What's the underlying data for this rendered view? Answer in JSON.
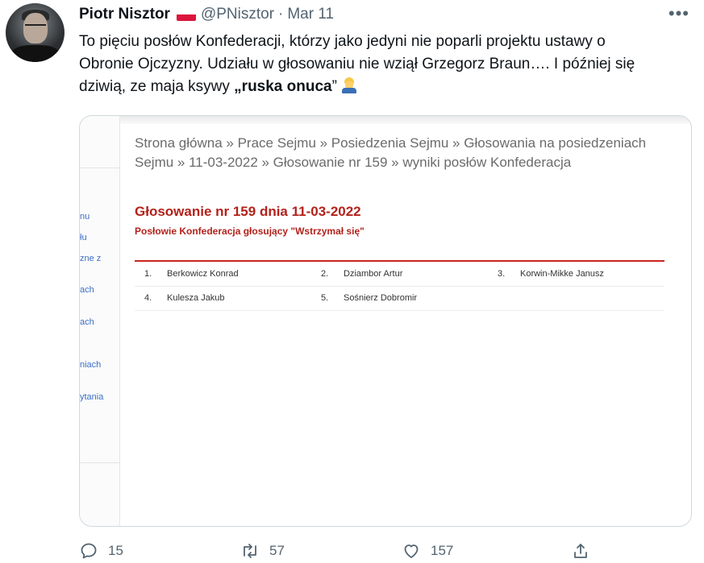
{
  "tweet": {
    "author_name": "Piotr Nisztor",
    "handle": "@PNisztor",
    "separator": "·",
    "date": "Mar 11",
    "more_label": "•••",
    "text_part1": "To pięciu posłów Konfederacji, którzy jako jedyni nie poparli projektu ustawy o Obronie Ojczyzny. Udziału w głosowaniu nie wziął Grzegorz Braun…. I później się dziwią, ze maja ksywy ",
    "text_bold": "„ruska onuca",
    "text_part2": "”",
    "flag_icon": "poland-flag-icon",
    "emoji_icon": "construction-worker-emoji"
  },
  "media": {
    "sidebar_items": [
      "nu",
      "łu",
      "zne z",
      "ach",
      "ach",
      "niach",
      "ytania"
    ],
    "breadcrumb": "Strona główna » Prace Sejmu » Posiedzenia Sejmu » Głosowania na posiedzeniach Sejmu » 11-03-2022 » Głosowanie nr 159 » wyniki posłów Konfederacja",
    "vote_title": "Głosowanie nr 159 dnia 11-03-2022",
    "vote_subtitle": "Posłowie Konfederacja głosujący \"Wstrzymał się\"",
    "members": [
      {
        "num": "1.",
        "name": "Berkowicz Konrad"
      },
      {
        "num": "2.",
        "name": "Dziambor Artur"
      },
      {
        "num": "3.",
        "name": "Korwin-Mikke Janusz"
      },
      {
        "num": "4.",
        "name": "Kulesza Jakub"
      },
      {
        "num": "5.",
        "name": "Sośnierz Dobromir"
      }
    ],
    "accent_color": "#c8261d"
  },
  "actions": {
    "replies": "15",
    "retweets": "57",
    "likes": "157"
  }
}
